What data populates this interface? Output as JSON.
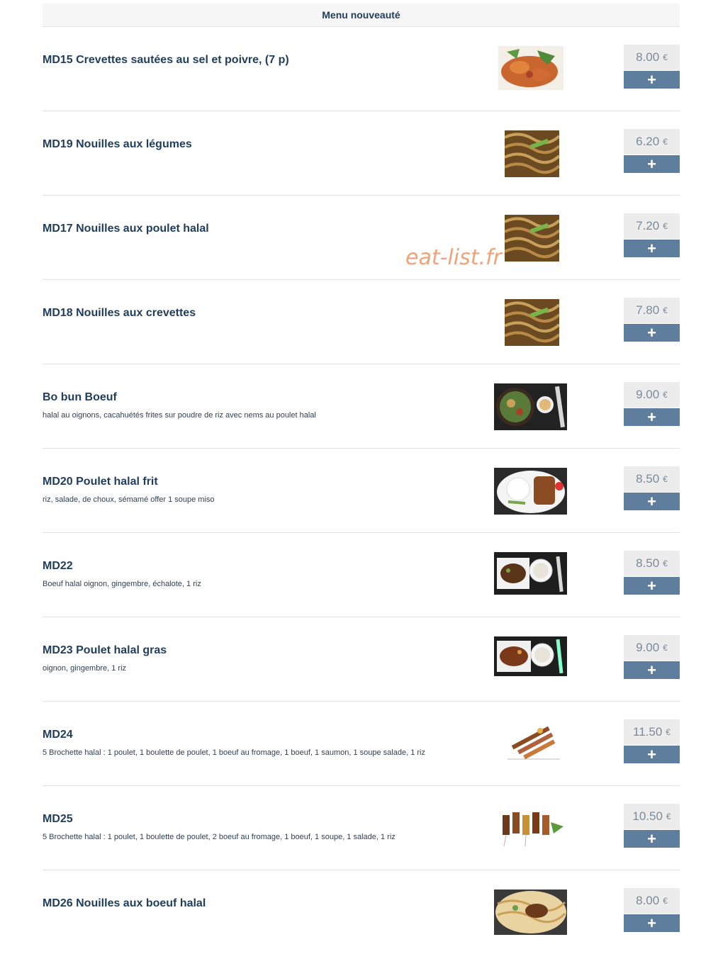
{
  "header": {
    "title": "Menu nouveauté"
  },
  "watermark": "eat-list.fr",
  "currency": "€",
  "add_label": "+",
  "items": [
    {
      "title": "MD15 Crevettes sautées au sel et poivre, (7 p)",
      "desc": "",
      "price": "8.00"
    },
    {
      "title": "MD19 Nouilles aux légumes",
      "desc": "",
      "price": "6.20"
    },
    {
      "title": "MD17 Nouilles aux poulet halal",
      "desc": "",
      "price": "7.20"
    },
    {
      "title": "MD18 Nouilles aux crevettes",
      "desc": "",
      "price": "7.80"
    },
    {
      "title": "Bo bun Boeuf",
      "desc": "halal au oignons, cacahuétés frites sur poudre de riz avec nems au poulet halal",
      "price": "9.00"
    },
    {
      "title": "MD20 Poulet halal frit",
      "desc": "riz, salade, de choux, sémamé offer 1 soupe miso",
      "price": "8.50"
    },
    {
      "title": "MD22",
      "desc": "Boeuf halal oignon, gingembre, échalote, 1 riz",
      "price": "8.50"
    },
    {
      "title": "MD23 Poulet halal gras",
      "desc": "oignon, gingembre, 1 riz",
      "price": "9.00"
    },
    {
      "title": "MD24",
      "desc": "5 Brochette halal : 1 poulet, 1 boulette de poulet, 1 boeuf au fromage, 1 boeuf, 1 saumon, 1 soupe salade, 1 riz",
      "price": "11.50"
    },
    {
      "title": "MD25",
      "desc": "5 Brochette halal : 1 poulet, 1 boulette de poulet, 2 boeuf au fromage, 1 boeuf, 1 soupe, 1 salade, 1 riz",
      "price": "10.50"
    },
    {
      "title": "MD26 Nouilles aux boeuf halal",
      "desc": "",
      "price": "8.00"
    }
  ]
}
